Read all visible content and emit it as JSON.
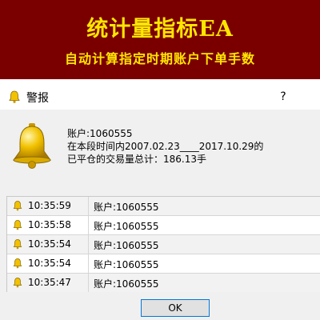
{
  "banner": {
    "title": "统计量指标EA",
    "subtitle": "自动计算指定时期账户下单手数"
  },
  "dialog": {
    "title": "警报",
    "help_label": "?",
    "message_lines": [
      "账户:1060555",
      "在本段时间内2007.02.23____2017.10.29的",
      "已平仓的交易量总计：186.13手"
    ],
    "ok_label": "OK"
  },
  "alerts": [
    {
      "time": "10:35:59",
      "message": "账户:1060555"
    },
    {
      "time": "10:35:58",
      "message": "账户:1060555"
    },
    {
      "time": "10:35:54",
      "message": "账户:1060555"
    },
    {
      "time": "10:35:54",
      "message": "账户:1060555"
    },
    {
      "time": "10:35:47",
      "message": "账户:1060555"
    }
  ],
  "colors": {
    "banner_bg": "#7a0000",
    "banner_text": "#ffe600",
    "bell": "#e8b800"
  }
}
